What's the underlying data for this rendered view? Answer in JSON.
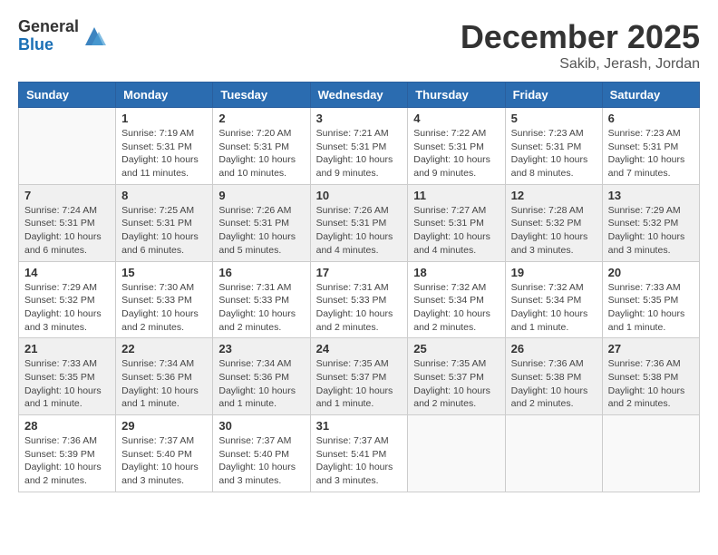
{
  "header": {
    "logo_general": "General",
    "logo_blue": "Blue",
    "month": "December 2025",
    "location": "Sakib, Jerash, Jordan"
  },
  "weekdays": [
    "Sunday",
    "Monday",
    "Tuesday",
    "Wednesday",
    "Thursday",
    "Friday",
    "Saturday"
  ],
  "weeks": [
    [
      {
        "day": "",
        "info": ""
      },
      {
        "day": "1",
        "info": "Sunrise: 7:19 AM\nSunset: 5:31 PM\nDaylight: 10 hours\nand 11 minutes."
      },
      {
        "day": "2",
        "info": "Sunrise: 7:20 AM\nSunset: 5:31 PM\nDaylight: 10 hours\nand 10 minutes."
      },
      {
        "day": "3",
        "info": "Sunrise: 7:21 AM\nSunset: 5:31 PM\nDaylight: 10 hours\nand 9 minutes."
      },
      {
        "day": "4",
        "info": "Sunrise: 7:22 AM\nSunset: 5:31 PM\nDaylight: 10 hours\nand 9 minutes."
      },
      {
        "day": "5",
        "info": "Sunrise: 7:23 AM\nSunset: 5:31 PM\nDaylight: 10 hours\nand 8 minutes."
      },
      {
        "day": "6",
        "info": "Sunrise: 7:23 AM\nSunset: 5:31 PM\nDaylight: 10 hours\nand 7 minutes."
      }
    ],
    [
      {
        "day": "7",
        "info": "Sunrise: 7:24 AM\nSunset: 5:31 PM\nDaylight: 10 hours\nand 6 minutes."
      },
      {
        "day": "8",
        "info": "Sunrise: 7:25 AM\nSunset: 5:31 PM\nDaylight: 10 hours\nand 6 minutes."
      },
      {
        "day": "9",
        "info": "Sunrise: 7:26 AM\nSunset: 5:31 PM\nDaylight: 10 hours\nand 5 minutes."
      },
      {
        "day": "10",
        "info": "Sunrise: 7:26 AM\nSunset: 5:31 PM\nDaylight: 10 hours\nand 4 minutes."
      },
      {
        "day": "11",
        "info": "Sunrise: 7:27 AM\nSunset: 5:31 PM\nDaylight: 10 hours\nand 4 minutes."
      },
      {
        "day": "12",
        "info": "Sunrise: 7:28 AM\nSunset: 5:32 PM\nDaylight: 10 hours\nand 3 minutes."
      },
      {
        "day": "13",
        "info": "Sunrise: 7:29 AM\nSunset: 5:32 PM\nDaylight: 10 hours\nand 3 minutes."
      }
    ],
    [
      {
        "day": "14",
        "info": "Sunrise: 7:29 AM\nSunset: 5:32 PM\nDaylight: 10 hours\nand 3 minutes."
      },
      {
        "day": "15",
        "info": "Sunrise: 7:30 AM\nSunset: 5:33 PM\nDaylight: 10 hours\nand 2 minutes."
      },
      {
        "day": "16",
        "info": "Sunrise: 7:31 AM\nSunset: 5:33 PM\nDaylight: 10 hours\nand 2 minutes."
      },
      {
        "day": "17",
        "info": "Sunrise: 7:31 AM\nSunset: 5:33 PM\nDaylight: 10 hours\nand 2 minutes."
      },
      {
        "day": "18",
        "info": "Sunrise: 7:32 AM\nSunset: 5:34 PM\nDaylight: 10 hours\nand 2 minutes."
      },
      {
        "day": "19",
        "info": "Sunrise: 7:32 AM\nSunset: 5:34 PM\nDaylight: 10 hours\nand 1 minute."
      },
      {
        "day": "20",
        "info": "Sunrise: 7:33 AM\nSunset: 5:35 PM\nDaylight: 10 hours\nand 1 minute."
      }
    ],
    [
      {
        "day": "21",
        "info": "Sunrise: 7:33 AM\nSunset: 5:35 PM\nDaylight: 10 hours\nand 1 minute."
      },
      {
        "day": "22",
        "info": "Sunrise: 7:34 AM\nSunset: 5:36 PM\nDaylight: 10 hours\nand 1 minute."
      },
      {
        "day": "23",
        "info": "Sunrise: 7:34 AM\nSunset: 5:36 PM\nDaylight: 10 hours\nand 1 minute."
      },
      {
        "day": "24",
        "info": "Sunrise: 7:35 AM\nSunset: 5:37 PM\nDaylight: 10 hours\nand 1 minute."
      },
      {
        "day": "25",
        "info": "Sunrise: 7:35 AM\nSunset: 5:37 PM\nDaylight: 10 hours\nand 2 minutes."
      },
      {
        "day": "26",
        "info": "Sunrise: 7:36 AM\nSunset: 5:38 PM\nDaylight: 10 hours\nand 2 minutes."
      },
      {
        "day": "27",
        "info": "Sunrise: 7:36 AM\nSunset: 5:38 PM\nDaylight: 10 hours\nand 2 minutes."
      }
    ],
    [
      {
        "day": "28",
        "info": "Sunrise: 7:36 AM\nSunset: 5:39 PM\nDaylight: 10 hours\nand 2 minutes."
      },
      {
        "day": "29",
        "info": "Sunrise: 7:37 AM\nSunset: 5:40 PM\nDaylight: 10 hours\nand 3 minutes."
      },
      {
        "day": "30",
        "info": "Sunrise: 7:37 AM\nSunset: 5:40 PM\nDaylight: 10 hours\nand 3 minutes."
      },
      {
        "day": "31",
        "info": "Sunrise: 7:37 AM\nSunset: 5:41 PM\nDaylight: 10 hours\nand 3 minutes."
      },
      {
        "day": "",
        "info": ""
      },
      {
        "day": "",
        "info": ""
      },
      {
        "day": "",
        "info": ""
      }
    ]
  ]
}
